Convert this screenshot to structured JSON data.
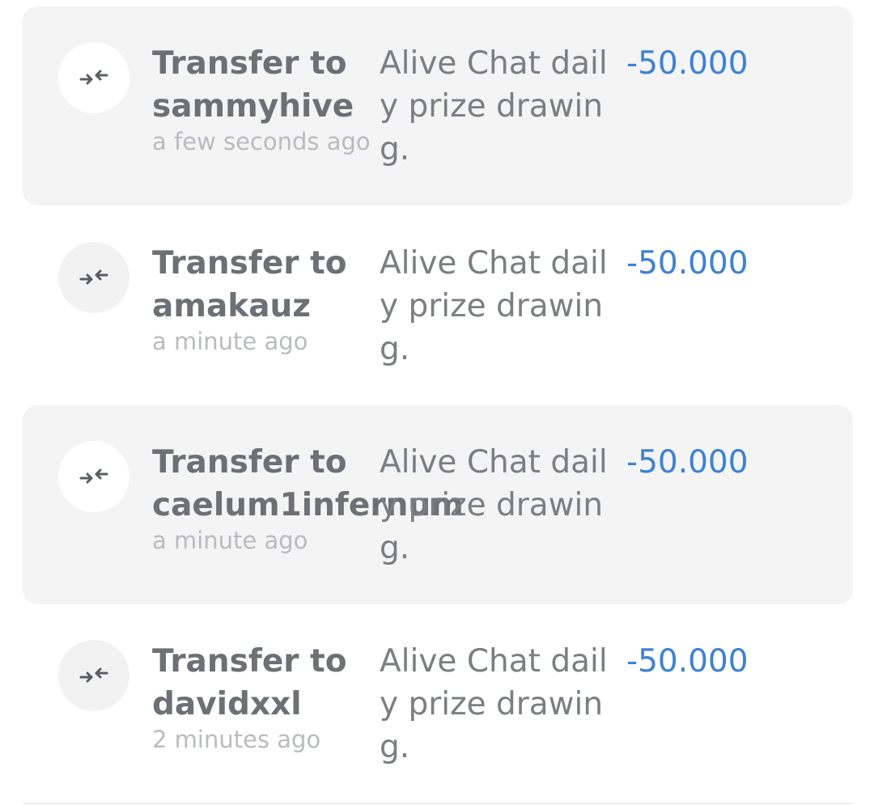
{
  "transactions": [
    {
      "icon": "transfer-arrows-icon",
      "title_line1": "Transfer to",
      "title_line2": "sammyhive",
      "time": "a few seconds ago",
      "memo_line1": "Alive Chat dail",
      "memo_line2": "y prize drawin",
      "memo_line3": "g.",
      "amount": "-50.000"
    },
    {
      "icon": "transfer-arrows-icon",
      "title_line1": "Transfer to",
      "title_line2": "amakauz",
      "time": "a minute ago",
      "memo_line1": "Alive Chat dail",
      "memo_line2": "y prize drawin",
      "memo_line3": "g.",
      "amount": "-50.000"
    },
    {
      "icon": "transfer-arrows-icon",
      "title_line1": "Transfer to",
      "title_line2": "caelum1infernum",
      "time": "a minute ago",
      "memo_line1": "Alive Chat dail",
      "memo_line2": "y prize drawin",
      "memo_line3": "g.",
      "amount": "-50.000"
    },
    {
      "icon": "transfer-arrows-icon",
      "title_line1": "Transfer to",
      "title_line2": "davidxxl",
      "time": "2 minutes ago",
      "memo_line1": "Alive Chat dail",
      "memo_line2": "y prize drawin",
      "memo_line3": "g.",
      "amount": "-50.000"
    }
  ],
  "colors": {
    "shaded_row_bg": "#f4f4f5",
    "title": "#6d7074",
    "timestamp": "#b9bbbe",
    "memo": "#7b7e82",
    "amount_negative": "#3b82d6"
  }
}
